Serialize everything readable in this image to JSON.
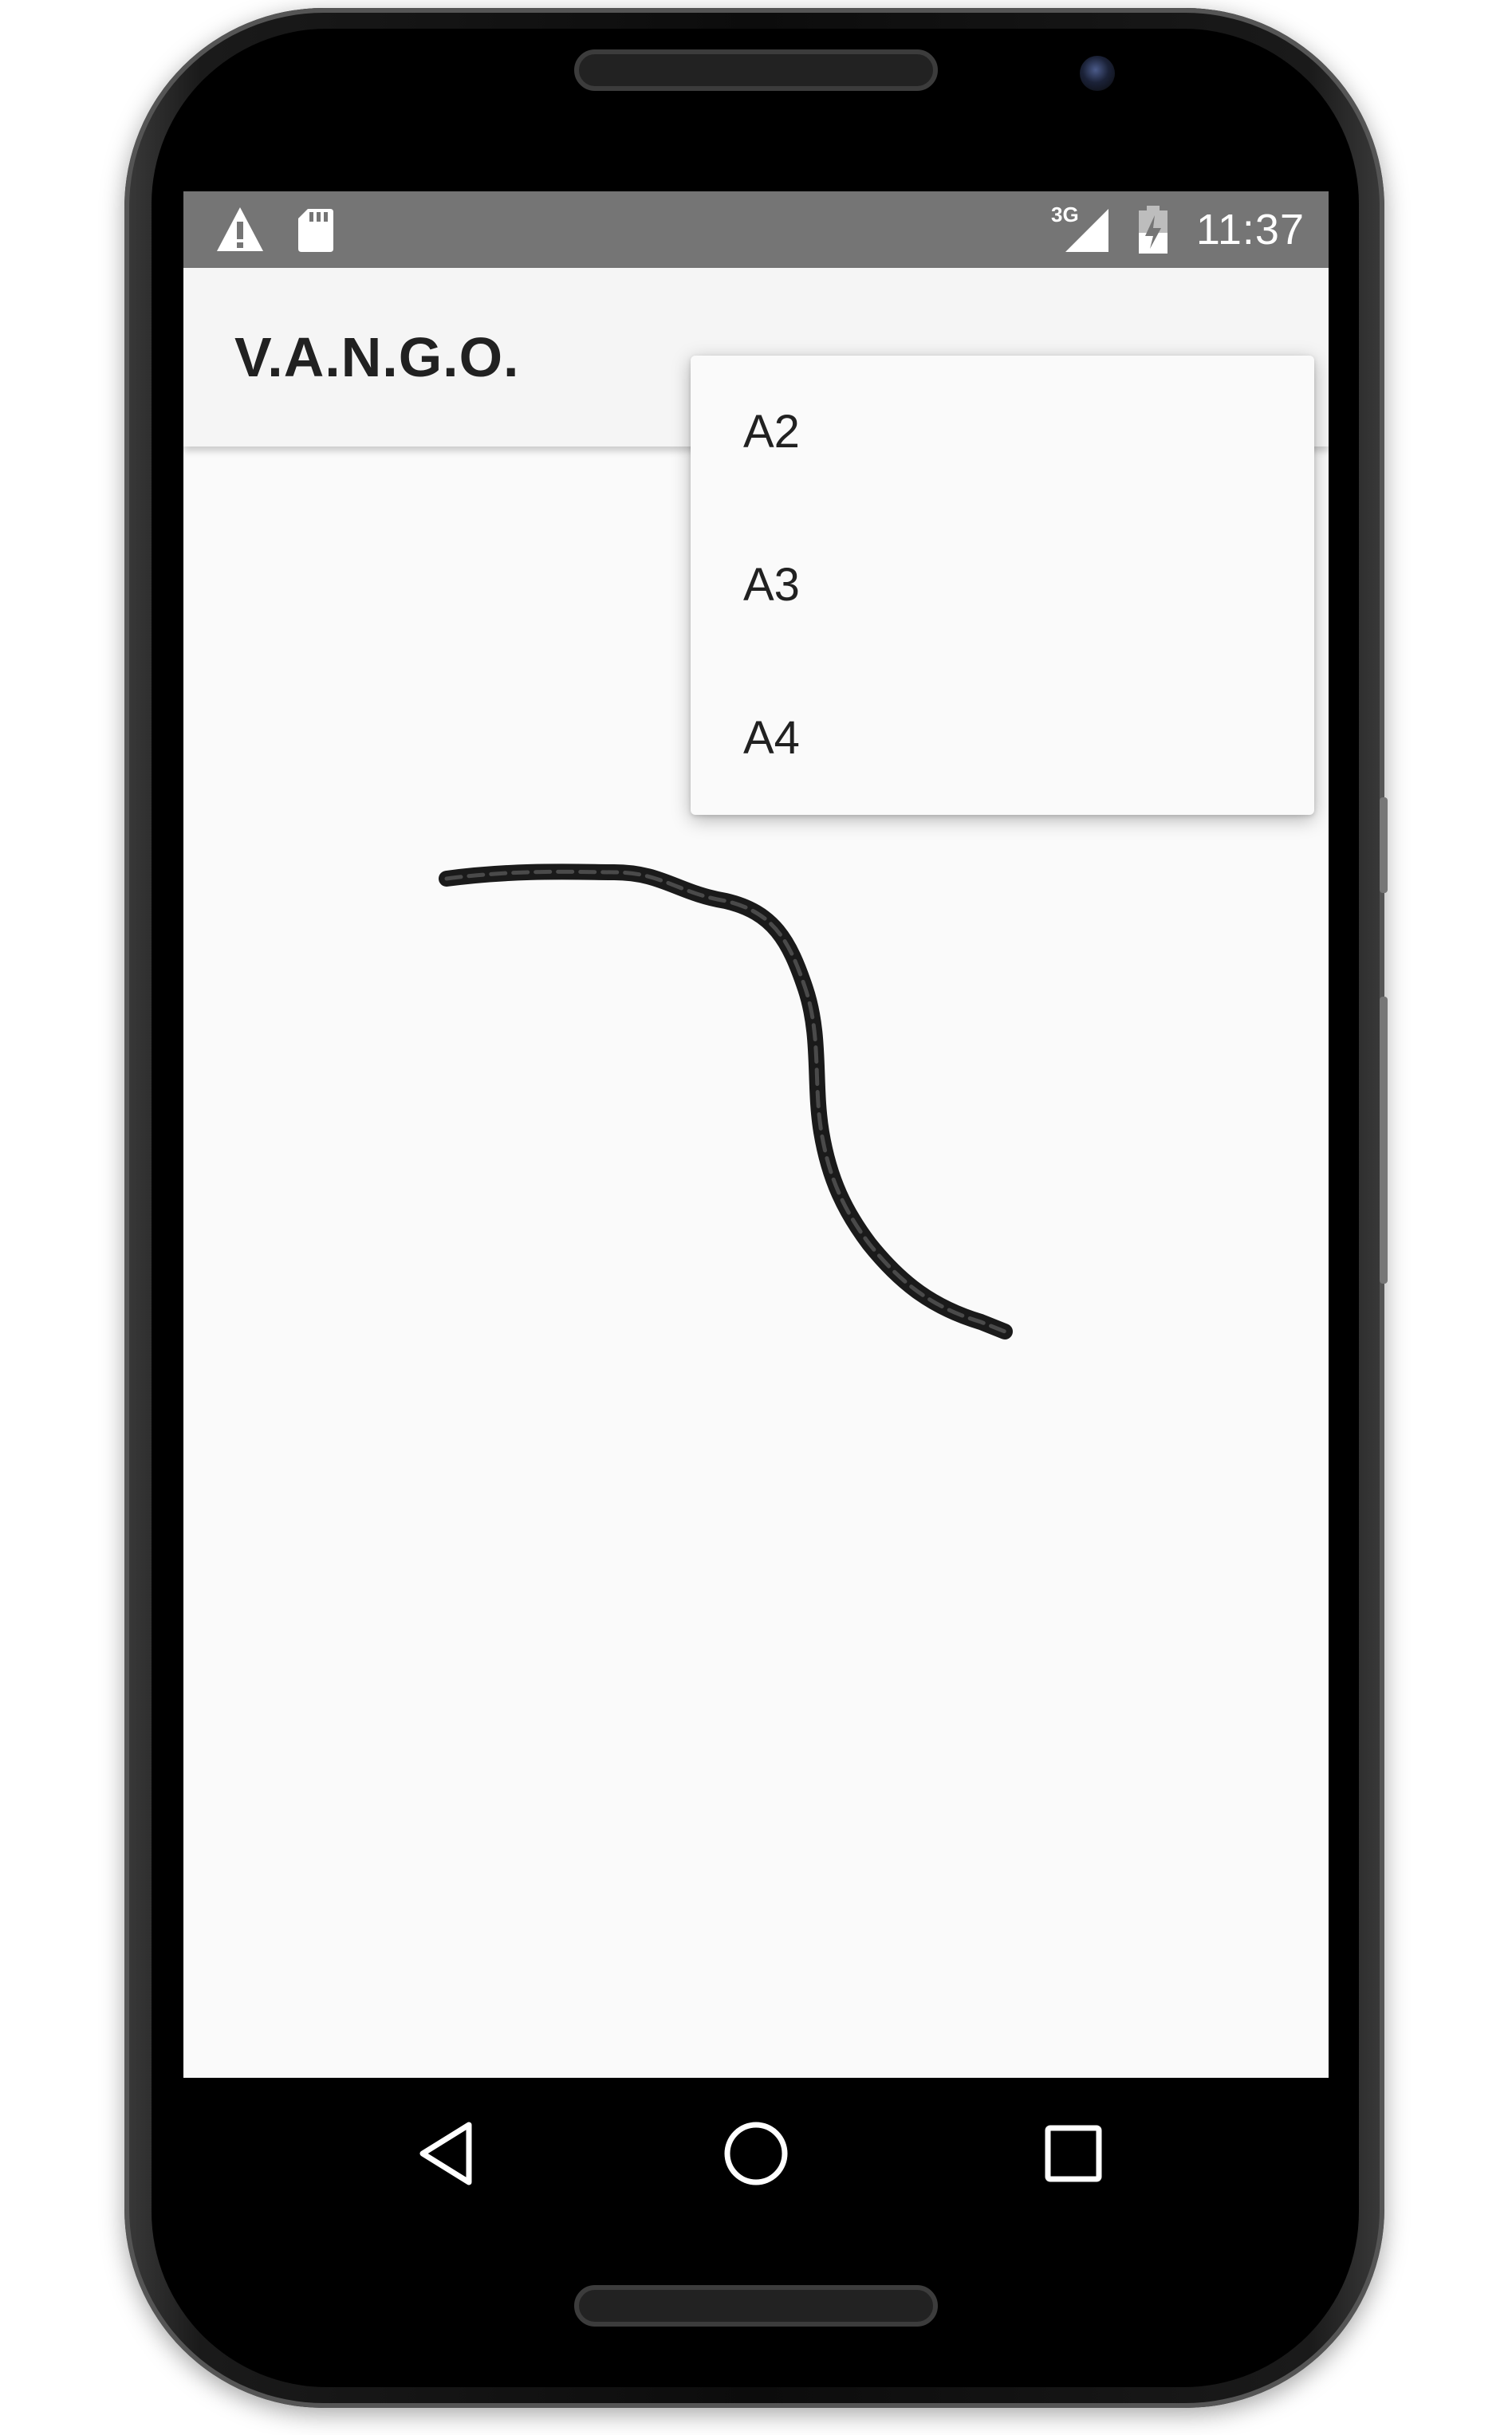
{
  "status_bar": {
    "time": "11:37",
    "network": "3G",
    "icons": [
      "warning-icon",
      "sd-card-icon",
      "signal-icon",
      "battery-icon"
    ]
  },
  "app": {
    "title": "V.A.N.G.O."
  },
  "menu": {
    "items": [
      "A2",
      "A3",
      "A4"
    ]
  },
  "nav_bar": {
    "buttons": [
      "back-icon",
      "home-icon",
      "recents-icon"
    ]
  },
  "colors": {
    "status_bar": "#757575",
    "toolbar": "#f5f5f5",
    "canvas": "#fafafa",
    "stroke": "#1a1a1a"
  }
}
